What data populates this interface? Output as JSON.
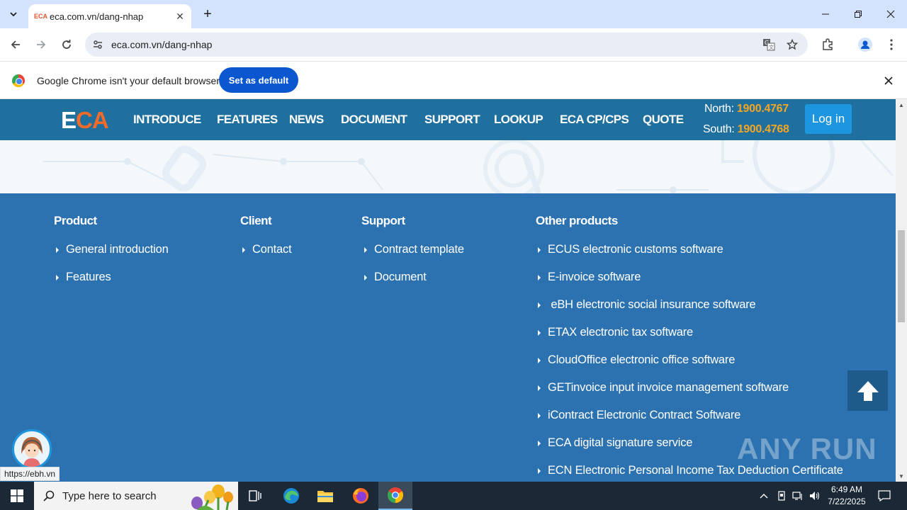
{
  "browser": {
    "tab_title": "eca.com.vn/dang-nhap",
    "tab_favicon": "ECA",
    "url": "eca.com.vn/dang-nhap"
  },
  "infobar": {
    "message": "Google Chrome isn't your default browser",
    "button_label": "Set as default"
  },
  "header": {
    "logo_e": "E",
    "logo_ca": "CA",
    "menu": [
      "INTRODUCE",
      "FEATURES",
      "NEWS",
      "DOCUMENT",
      "SUPPORT",
      "LOOKUP",
      "ECA CP/CPS",
      "QUOTE"
    ],
    "north_label": "North: ",
    "north_number": "1900.4767",
    "south_label": "South: ",
    "south_number": "1900.4768",
    "login_label": "Log in"
  },
  "footer": {
    "product": {
      "title": "Product",
      "links": [
        "General introduction",
        "Features"
      ]
    },
    "client": {
      "title": "Client",
      "links": [
        "Contact"
      ]
    },
    "support": {
      "title": "Support",
      "links": [
        "Contract template",
        "Document"
      ]
    },
    "other": {
      "title": "Other products",
      "links": [
        "ECUS electronic customs software",
        "E-invoice software",
        " eBH electronic social insurance software",
        "ETAX electronic tax software",
        "CloudOffice electronic office software",
        "GETinvoice input invoice management software",
        "iContract Electronic Contract Software",
        "ECA digital signature service",
        "ECN Electronic Personal Income Tax Deduction Certificate"
      ]
    }
  },
  "watermark": "ANY RUN",
  "status_url": "https://ebh.vn",
  "taskbar": {
    "search_placeholder": "Type here to search",
    "time": "6:49 AM",
    "date": "7/22/2025"
  }
}
